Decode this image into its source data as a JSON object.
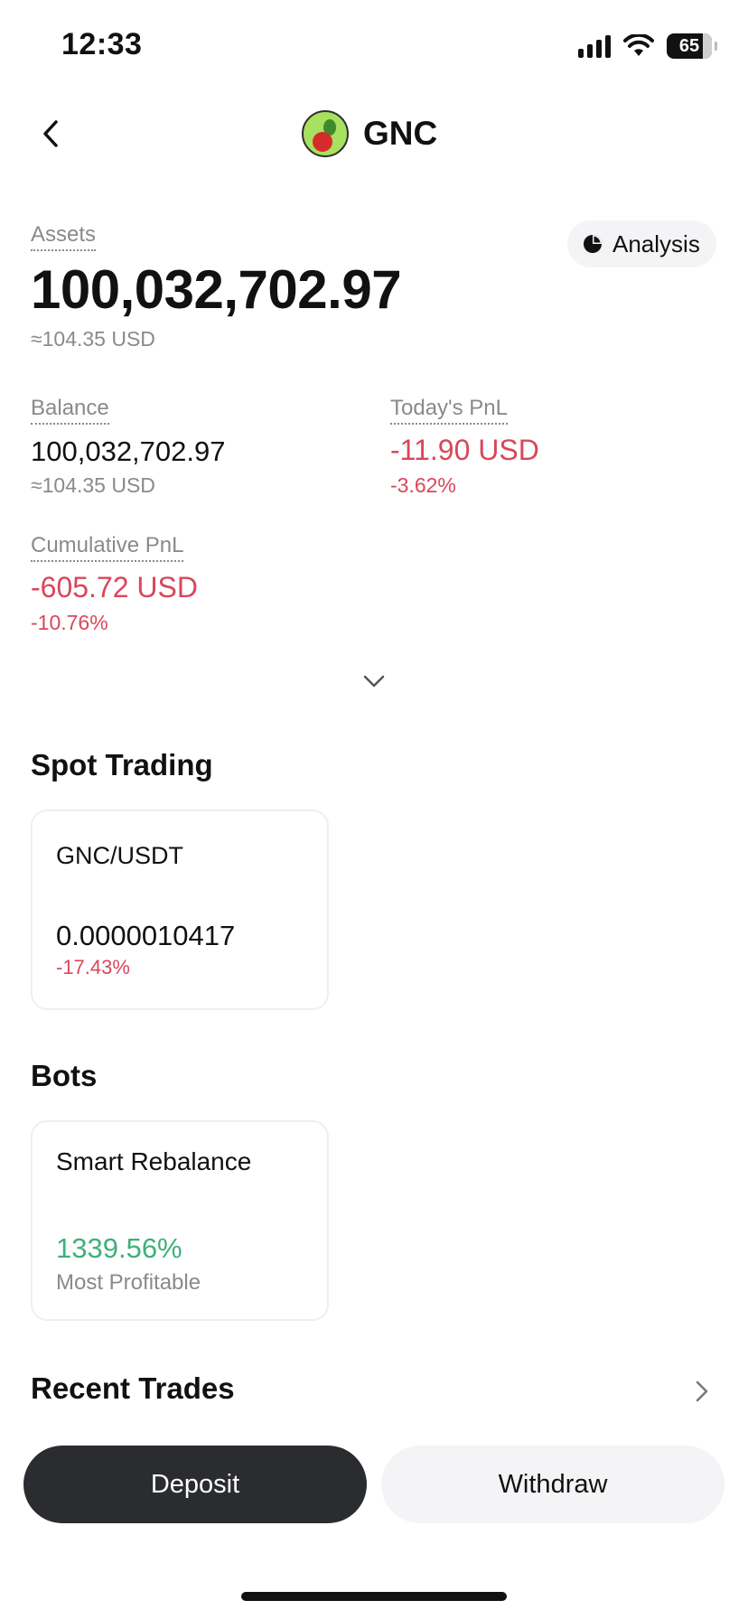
{
  "status_bar": {
    "time": "12:33",
    "battery": "65"
  },
  "header": {
    "title": "GNC"
  },
  "assets": {
    "label": "Assets",
    "value": "100,032,702.97",
    "usd": "≈104.35 USD",
    "analysis_label": "Analysis"
  },
  "balance": {
    "label": "Balance",
    "value": "100,032,702.97",
    "usd": "≈104.35 USD"
  },
  "todays_pnl": {
    "label": "Today's PnL",
    "value": "-11.90 USD",
    "percent": "-3.62%"
  },
  "cumulative_pnl": {
    "label": "Cumulative PnL",
    "value": "-605.72 USD",
    "percent": "-10.76%"
  },
  "spot_trading": {
    "title": "Spot Trading",
    "pair": "GNC/USDT",
    "price": "0.0000010417",
    "change": "-17.43%"
  },
  "bots": {
    "title": "Bots",
    "name": "Smart Rebalance",
    "profit": "1339.56%",
    "subtitle": "Most Profitable"
  },
  "recent_trades": {
    "title": "Recent Trades"
  },
  "actions": {
    "deposit": "Deposit",
    "withdraw": "Withdraw"
  },
  "colors": {
    "negative": "#d9475a",
    "positive": "#3fb07a",
    "primary_button": "#2b2c30"
  },
  "icons": [
    "back-chevron-icon",
    "pie-chart-icon",
    "chevron-down-icon",
    "chevron-right-icon",
    "signal-icon",
    "wifi-icon",
    "battery-icon"
  ]
}
